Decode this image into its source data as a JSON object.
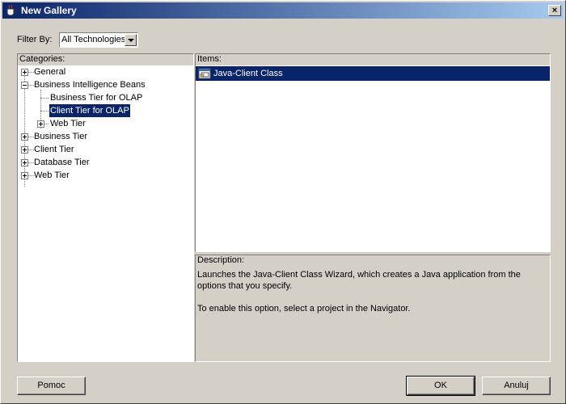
{
  "window": {
    "title": "New Gallery",
    "close_glyph": "×"
  },
  "filter": {
    "label": "Filter By:",
    "value": "All Technologies"
  },
  "categories": {
    "header": "Categories:",
    "nodes": [
      {
        "label": "General",
        "state": "collapsed"
      },
      {
        "label": "Business Intelligence Beans",
        "state": "expanded"
      },
      {
        "label": "Business Tier for OLAP",
        "state": "leaf"
      },
      {
        "label": "Client Tier for OLAP",
        "state": "leaf",
        "selected": true
      },
      {
        "label": "Web Tier",
        "state": "collapsed"
      },
      {
        "label": "Business Tier",
        "state": "collapsed"
      },
      {
        "label": "Client Tier",
        "state": "collapsed"
      },
      {
        "label": "Database Tier",
        "state": "collapsed"
      },
      {
        "label": "Web Tier",
        "state": "collapsed"
      }
    ]
  },
  "items": {
    "header": "Items:",
    "list": [
      {
        "label": "Java-Client Class",
        "icon": "java-class-icon",
        "selected": true
      }
    ]
  },
  "description": {
    "header": "Description:",
    "line1": "Launches the Java-Client Class Wizard, which creates a Java application from the options that you specify.",
    "line2": "To enable this option, select a project in the Navigator."
  },
  "buttons": {
    "help": "Pomoc",
    "ok": "OK",
    "cancel": "Anuluj"
  },
  "colors": {
    "selection": "#0a246a",
    "title_start": "#0a246a",
    "title_end": "#a6caf0",
    "face": "#d4d0c8"
  }
}
